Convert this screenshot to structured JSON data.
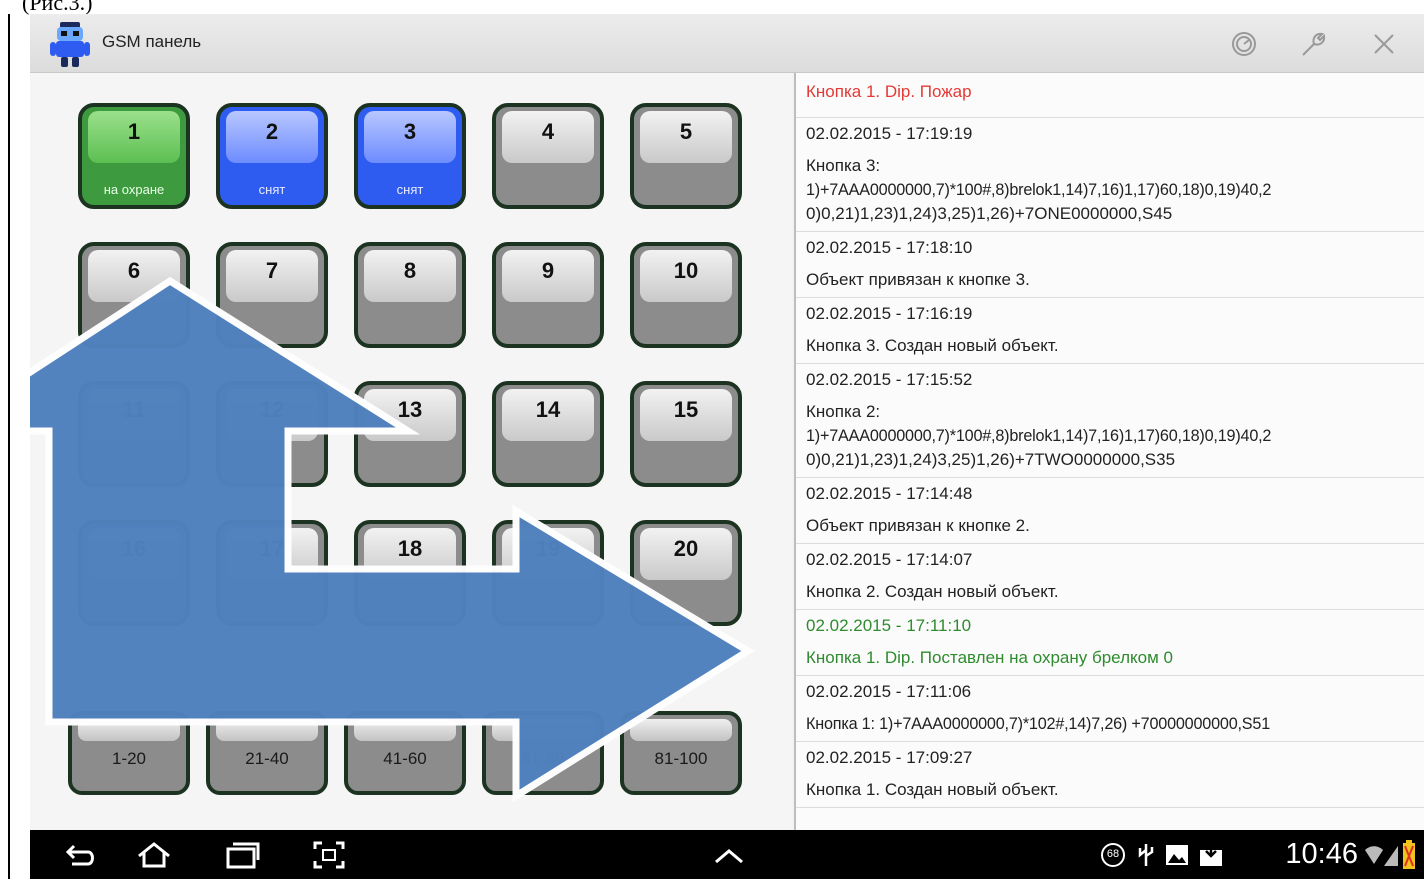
{
  "document": {
    "caption": "(Рис.3.)"
  },
  "app": {
    "title": "GSM панель"
  },
  "titlebar_icons": [
    "clock-icon",
    "wrench-icon",
    "close-icon"
  ],
  "colors": {
    "alarm": "#e53935",
    "armed": "#2e8b2e",
    "disarmed": "#2f5cf0",
    "arrow": "#4f81bd"
  },
  "grid": {
    "buttons": [
      {
        "num": "1",
        "status": "на охране",
        "state": "armed"
      },
      {
        "num": "2",
        "status": "снят",
        "state": "disarmed"
      },
      {
        "num": "3",
        "status": "снят",
        "state": "disarmed"
      },
      {
        "num": "4",
        "status": "",
        "state": "empty"
      },
      {
        "num": "5",
        "status": "",
        "state": "empty"
      },
      {
        "num": "6",
        "status": "",
        "state": "empty"
      },
      {
        "num": "7",
        "status": "",
        "state": "empty"
      },
      {
        "num": "8",
        "status": "",
        "state": "empty"
      },
      {
        "num": "9",
        "status": "",
        "state": "empty"
      },
      {
        "num": "10",
        "status": "",
        "state": "empty"
      },
      {
        "num": "11",
        "status": "",
        "state": "empty"
      },
      {
        "num": "12",
        "status": "",
        "state": "empty"
      },
      {
        "num": "13",
        "status": "",
        "state": "empty"
      },
      {
        "num": "14",
        "status": "",
        "state": "empty"
      },
      {
        "num": "15",
        "status": "",
        "state": "empty"
      },
      {
        "num": "16",
        "status": "",
        "state": "empty"
      },
      {
        "num": "17",
        "status": "",
        "state": "empty"
      },
      {
        "num": "18",
        "status": "",
        "state": "empty"
      },
      {
        "num": "19",
        "status": "",
        "state": "empty"
      },
      {
        "num": "20",
        "status": "",
        "state": "empty"
      }
    ]
  },
  "pages": [
    "1-20",
    "21-40",
    "41-60",
    "61-80",
    "81-100"
  ],
  "log": [
    {
      "lines": [
        "Кнопка 1. Dip. Пожар"
      ],
      "color": "#e53935"
    },
    {
      "lines": [
        "02.02.2015 - 17:19:19",
        "Кнопка 3:",
        "1)+7AAA0000000,7)*100#,8)brelok1,14)7,16)1,17)60,18)0,19)40,2",
        "0)0,21)1,23)1,24)3,25)1,26)+7ONE0000000,S45"
      ],
      "color": "#222222"
    },
    {
      "lines": [
        "02.02.2015 - 17:18:10",
        "Объект привязан к кнопке 3."
      ],
      "color": "#222222"
    },
    {
      "lines": [
        "02.02.2015 - 17:16:19",
        "Кнопка 3. Создан новый объект."
      ],
      "color": "#222222"
    },
    {
      "lines": [
        "02.02.2015 - 17:15:52",
        "Кнопка 2:",
        "1)+7AAA0000000,7)*100#,8)brelok1,14)7,16)1,17)60,18)0,19)40,2",
        "0)0,21)1,23)1,24)3,25)1,26)+7TWO0000000,S35"
      ],
      "color": "#222222"
    },
    {
      "lines": [
        "02.02.2015 - 17:14:48",
        "Объект привязан к кнопке 2."
      ],
      "color": "#222222"
    },
    {
      "lines": [
        "02.02.2015 - 17:14:07",
        "Кнопка 2. Создан новый объект."
      ],
      "color": "#222222"
    },
    {
      "lines": [
        "02.02.2015 - 17:11:10",
        "Кнопка 1. Dip. Поставлен на охрану брелком 0"
      ],
      "color": "#2e8b2e"
    },
    {
      "lines": [
        "02.02.2015 - 17:11:06",
        "Кнопка 1: 1)+7AAA0000000,7)*102#,14)7,26) +70000000000,S51"
      ],
      "color": "#222222"
    },
    {
      "lines": [
        "02.02.2015 - 17:09:27",
        "Кнопка 1. Создан новый объект."
      ],
      "color": "#222222"
    }
  ],
  "navbar": {
    "icons": [
      "back-icon",
      "home-icon",
      "recent-apps-icon",
      "screenshot-icon",
      "chevron-up-icon"
    ],
    "status_icons": [
      "notification-badge",
      "usb-icon",
      "gallery-icon",
      "download-icon",
      "wifi-icon",
      "signal-icon",
      "battery-icon"
    ],
    "badge": "68",
    "time": "10:46"
  }
}
